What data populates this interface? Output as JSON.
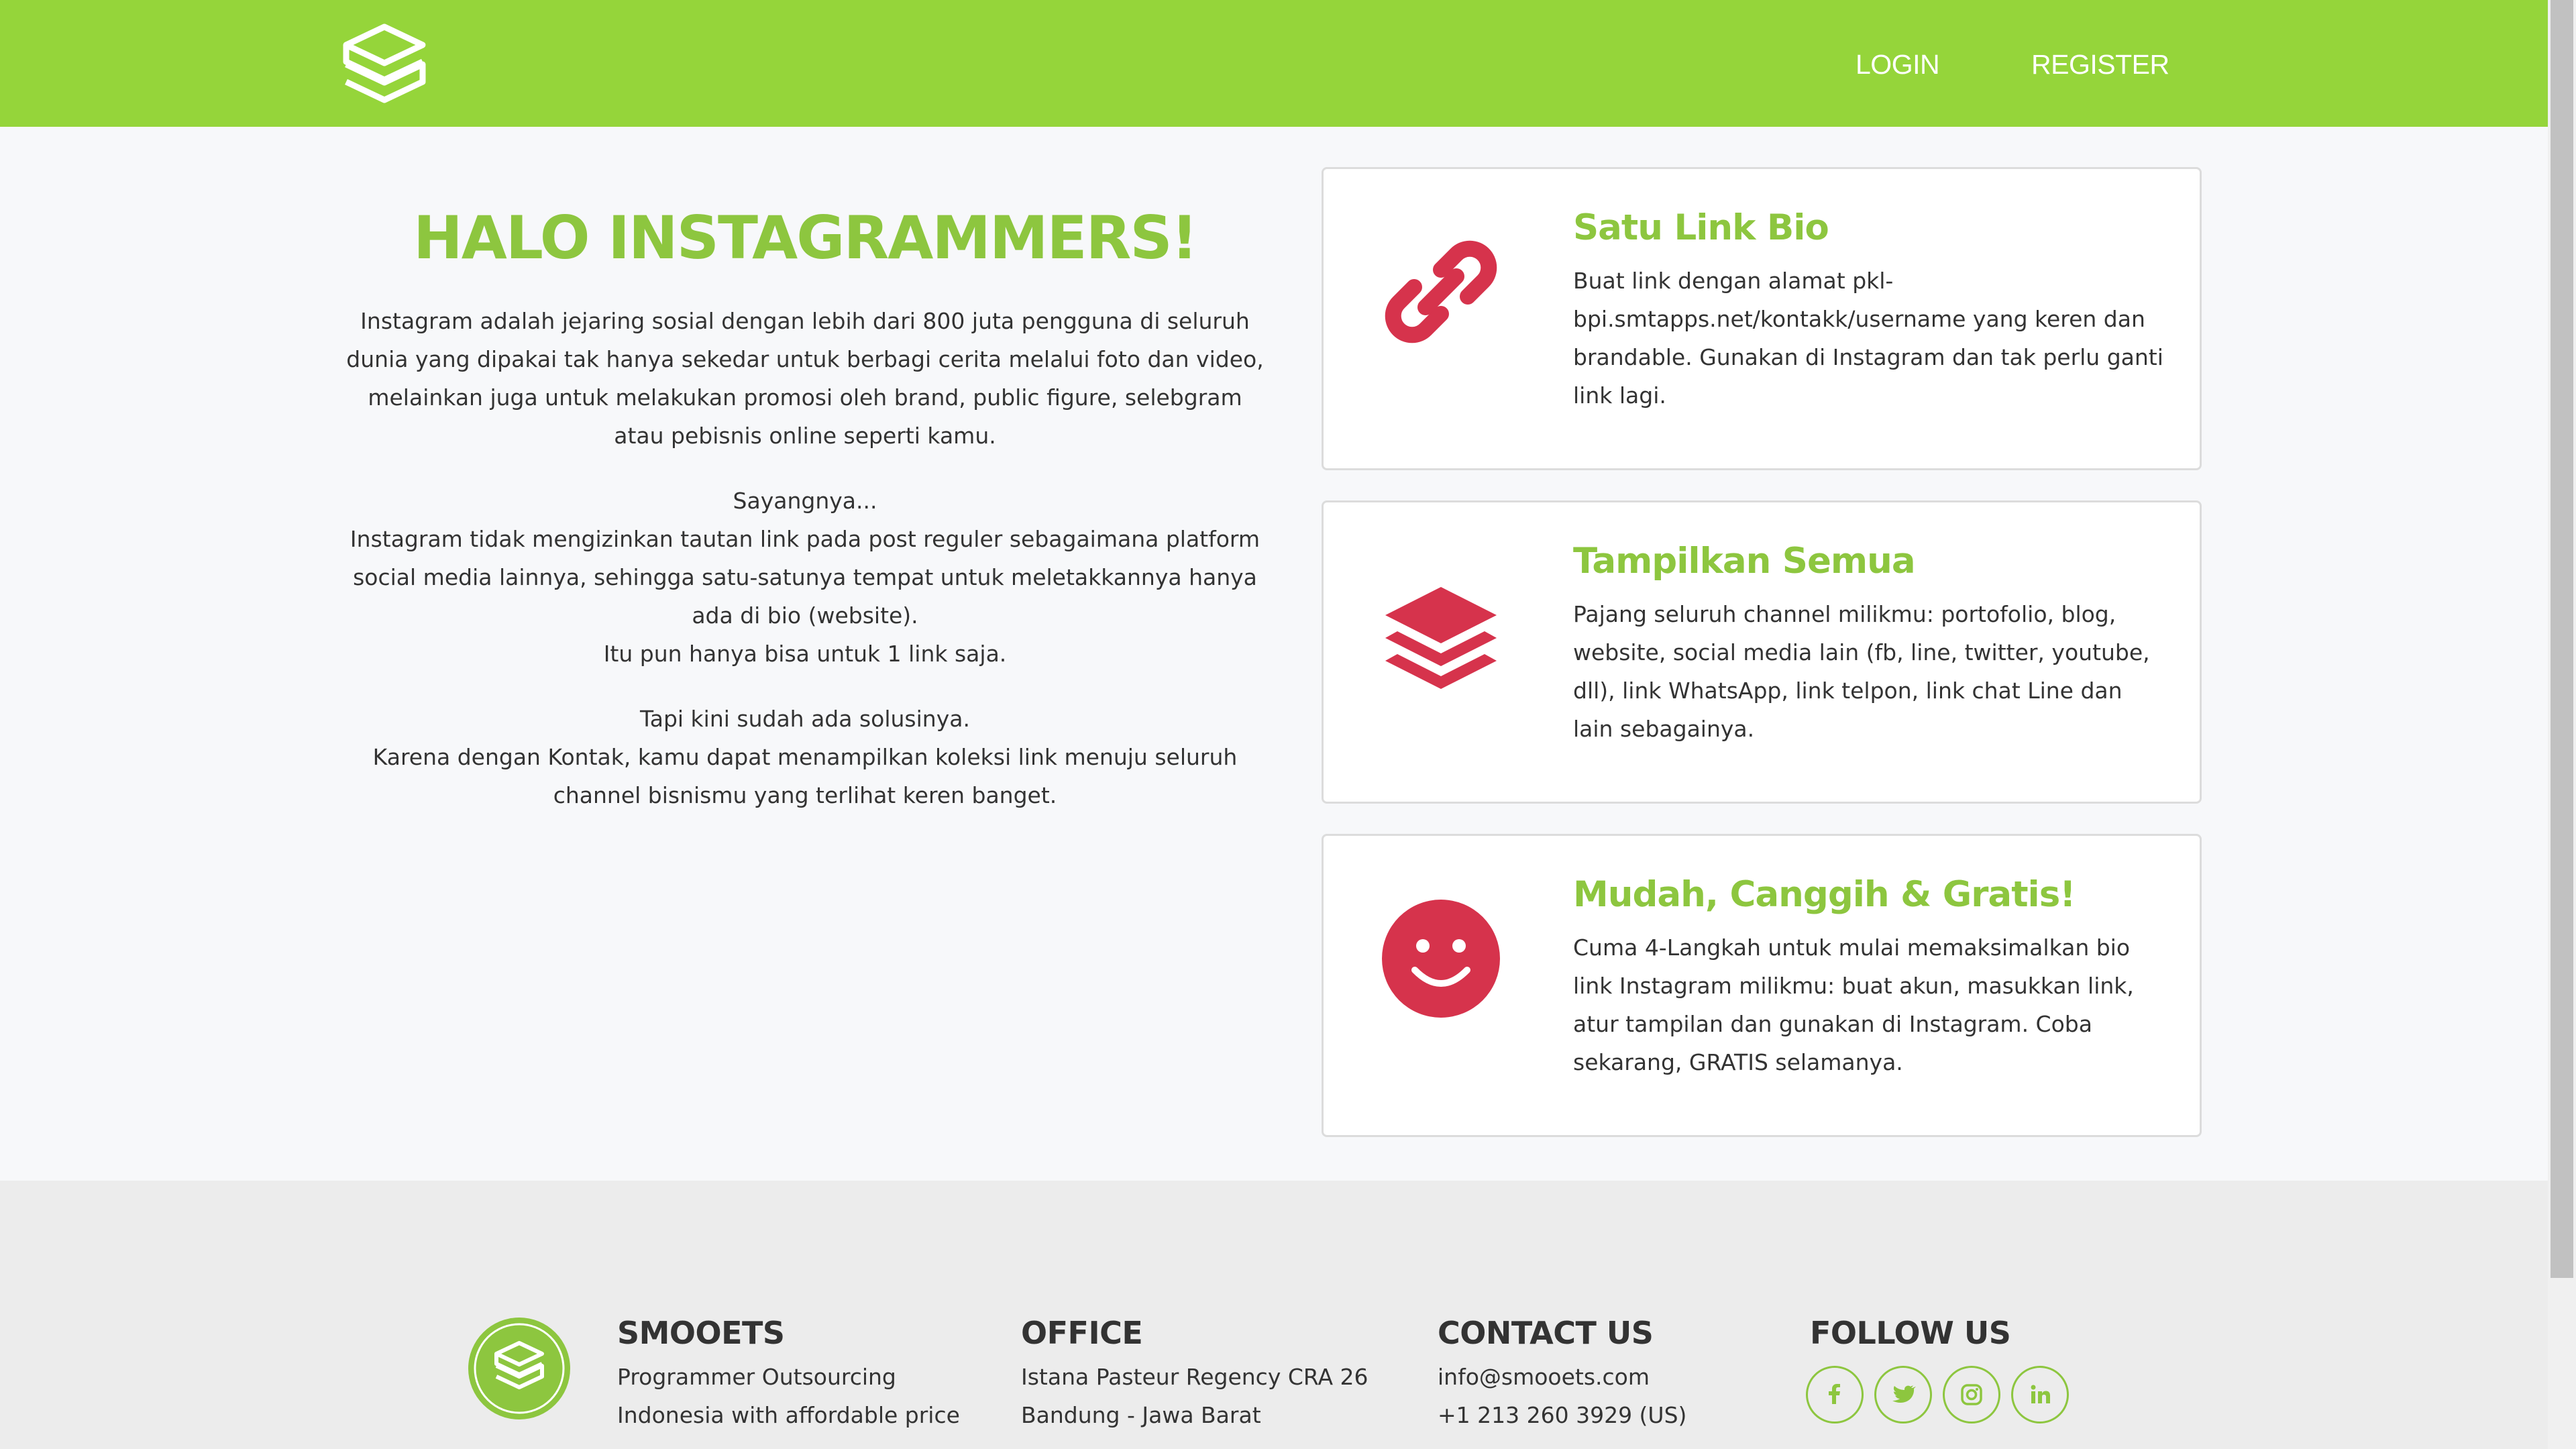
{
  "nav": {
    "login_label": "LOGIN",
    "register_label": "REGISTER"
  },
  "intro": {
    "title": "HALO INSTAGRAMMERS!",
    "paragraph1": "Instagram adalah jejaring sosial dengan lebih dari 800 juta pengguna di seluruh dunia yang dipakai tak hanya sekedar untuk berbagi cerita melalui foto dan video, melainkan juga untuk melakukan promosi oleh brand, public figure, selebgram atau pebisnis online seperti kamu.",
    "paragraph2_line1": "Sayangnya...",
    "paragraph2_line2": "Instagram tidak mengizinkan tautan link pada post reguler sebagaimana platform social media lainnya, sehingga satu-satunya tempat untuk meletakkannya hanya ada di bio (website).",
    "paragraph2_line3": "Itu pun hanya bisa untuk 1 link saja.",
    "paragraph3_line1": "Tapi kini sudah ada solusinya.",
    "paragraph3_line2": "Karena dengan Kontak, kamu dapat menampilkan koleksi link menuju seluruh channel bisnismu yang terlihat keren banget."
  },
  "features": [
    {
      "icon": "link-icon",
      "title": "Satu Link Bio",
      "text": "Buat link dengan alamat pkl-bpi.smtapps.net/kontakk/username yang keren dan brandable. Gunakan di Instagram dan tak perlu ganti link lagi."
    },
    {
      "icon": "layers-icon",
      "title": "Tampilkan Semua",
      "text": "Pajang seluruh channel milikmu: portofolio, blog, website, social media lain (fb, line, twitter, youtube, dll), link WhatsApp, link telpon, link chat Line dan lain sebagainya."
    },
    {
      "icon": "smile-icon",
      "title": "Mudah, Canggih & Gratis!",
      "text": "Cuma 4-Langkah untuk mulai memaksimalkan bio link Instagram milikmu: buat akun, masukkan link, atur tampilan dan gunakan di Instagram. Coba sekarang, GRATIS selamanya."
    }
  ],
  "footer": {
    "company": {
      "heading": "SMOOETS",
      "line1": "Programmer Outsourcing",
      "line2": "Indonesia with affordable price"
    },
    "office": {
      "heading": "OFFICE",
      "line1": "Istana Pasteur Regency CRA 26",
      "line2": "Bandung - Jawa Barat"
    },
    "contact": {
      "heading": "CONTACT US",
      "email": "info@smooets.com",
      "phone": "+1 213 260 3929 (US)"
    },
    "follow": {
      "heading": "FOLLOW US",
      "icons": [
        "facebook-icon",
        "twitter-icon",
        "instagram-icon",
        "linkedin-icon"
      ]
    }
  },
  "colors": {
    "brand_green": "#95d53a",
    "title_green": "#8dc63f",
    "icon_red": "#d6334c"
  }
}
